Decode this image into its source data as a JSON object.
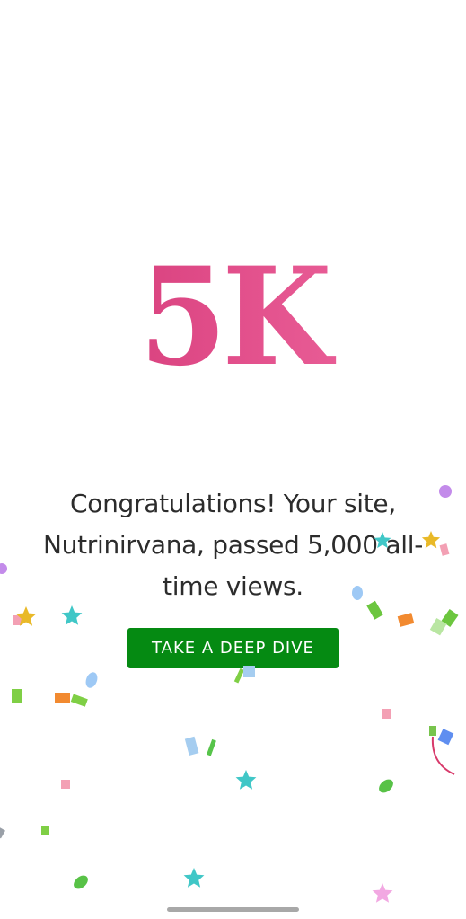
{
  "milestone": {
    "badge_text": "5K",
    "message": "Congratulations! Your site, Nutrinirvana, passed 5,000 all-time views."
  },
  "cta": {
    "label": "TAKE A DEEP DIVE"
  },
  "colors": {
    "badge_gradient_start": "#cf3472",
    "badge_gradient_end": "#ee6aa0",
    "button_background": "#058a12",
    "button_text": "#ffffff",
    "message_text": "#2c2c2c"
  },
  "icons": {
    "confetti": "confetti-icon",
    "star": "star-icon"
  }
}
